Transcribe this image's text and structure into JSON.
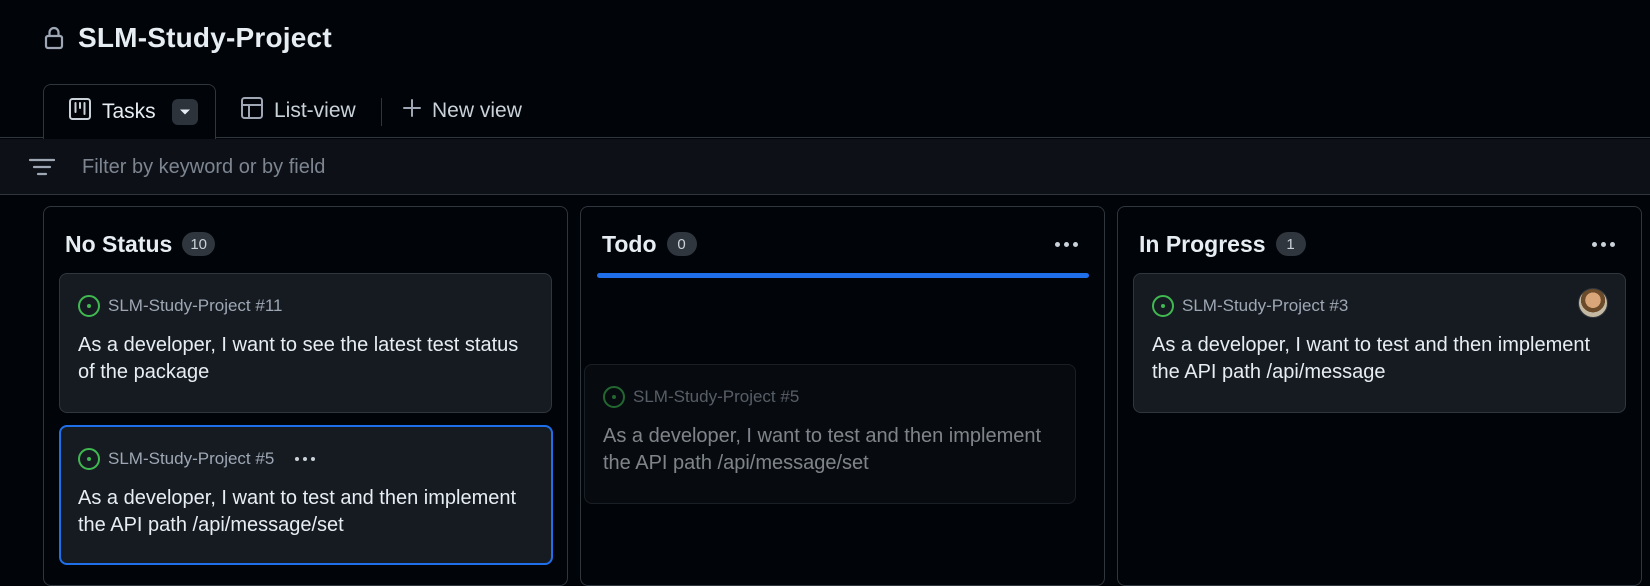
{
  "project": {
    "title": "SLM-Study-Project",
    "icon": "lock-icon"
  },
  "tabs": [
    {
      "label": "Tasks",
      "icon": "board-icon",
      "active": true
    },
    {
      "label": "List-view",
      "icon": "table-icon",
      "active": false
    },
    {
      "label": "New view",
      "icon": "plus-icon",
      "active": false
    }
  ],
  "filter": {
    "placeholder": "Filter by keyword or by field",
    "value": ""
  },
  "columns": [
    {
      "title": "No Status",
      "count": "10",
      "cards": [
        {
          "ref": "SLM-Study-Project #11",
          "body": "As a developer, I want to see the latest test status of the package"
        },
        {
          "ref": "SLM-Study-Project #5",
          "body": "As a developer, I want to test and then implement the API path /api/message/set"
        }
      ]
    },
    {
      "title": "Todo",
      "count": "0",
      "ghost_card": {
        "ref": "SLM-Study-Project #5",
        "body": "As a developer, I want to test and then implement the API path /api/message/set"
      }
    },
    {
      "title": "In Progress",
      "count": "1",
      "cards": [
        {
          "ref": "SLM-Study-Project #3",
          "body": "As a developer, I want to test and then implement the API path /api/message"
        }
      ]
    }
  ],
  "colors": {
    "accent": "#1f6feb",
    "open_issue": "#3fb950",
    "background": "#010409"
  }
}
